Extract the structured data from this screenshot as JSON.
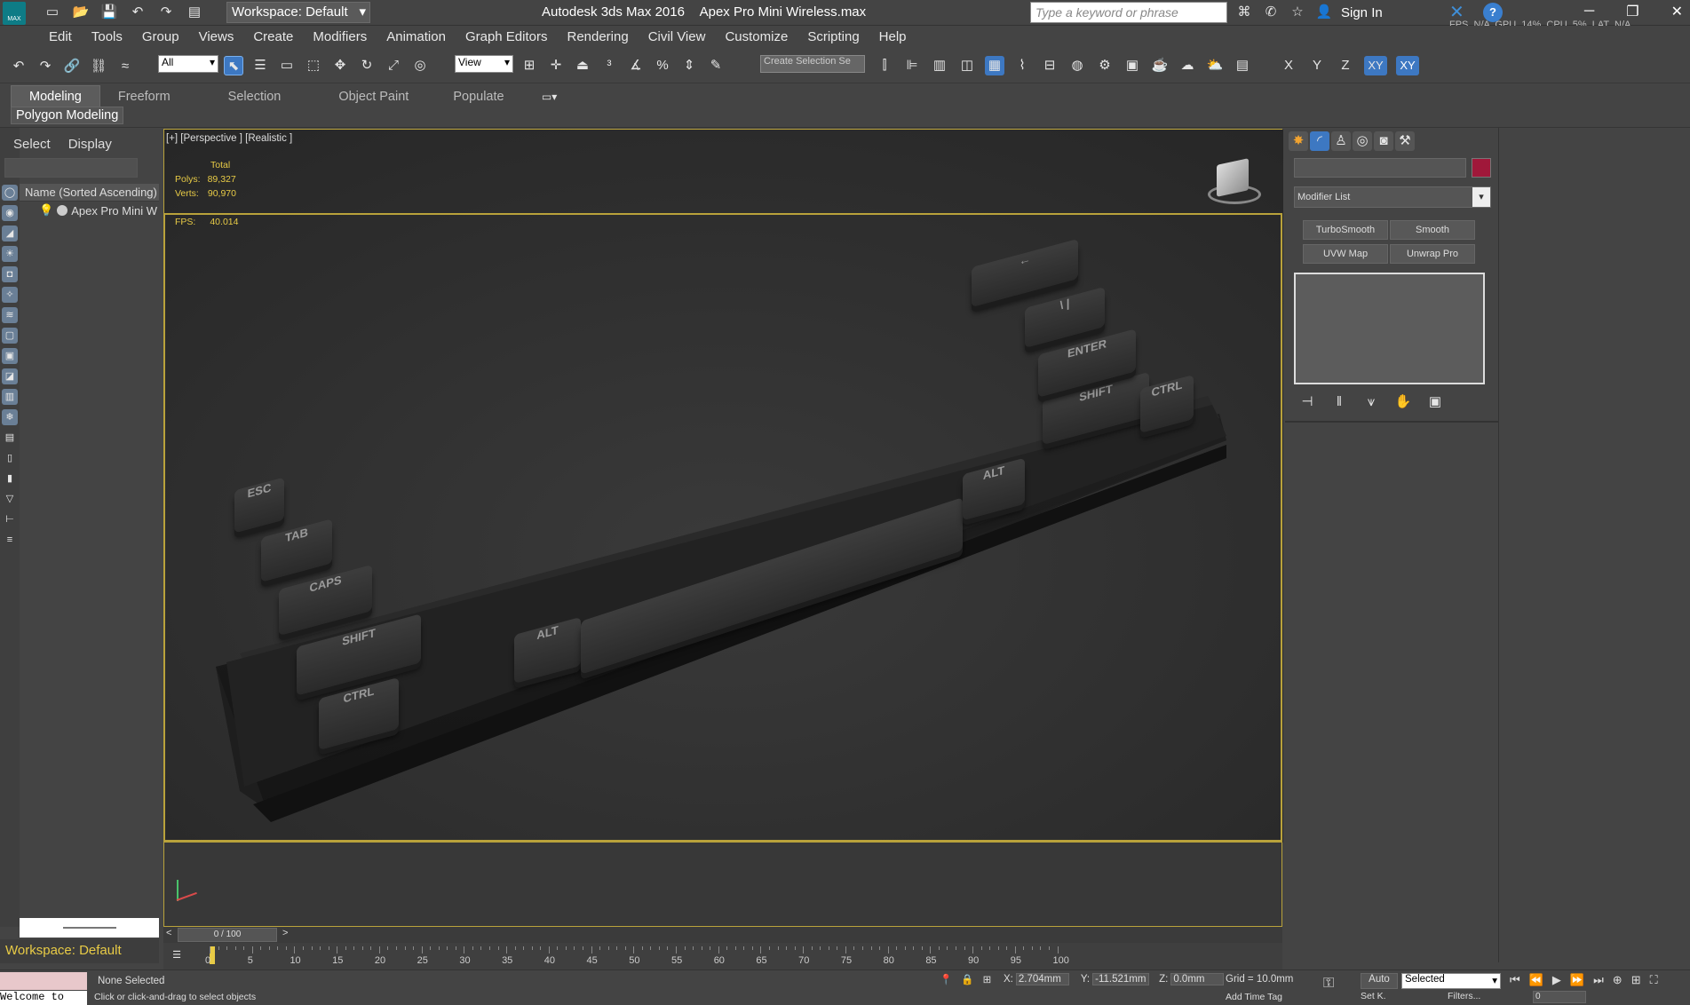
{
  "titlebar": {
    "workspace_label": "Workspace: Default",
    "app_title": "Autodesk 3ds Max 2016",
    "file_name": "Apex Pro Mini Wireless.max",
    "search_placeholder": "Type a keyword or phrase",
    "sign_in": "Sign In",
    "app_logo": "MAX",
    "stats": "FPS  N/A  GPU  14%  CPU  5%  LAT  N/A"
  },
  "menubar": {
    "items": [
      "Edit",
      "Tools",
      "Group",
      "Views",
      "Create",
      "Modifiers",
      "Animation",
      "Graph Editors",
      "Rendering",
      "Civil View",
      "Customize",
      "Scripting",
      "Help"
    ]
  },
  "toolbar": {
    "filter_select": "All",
    "coord_select": "View",
    "selection_set_placeholder": "Create Selection Se",
    "axes": [
      "X",
      "Y",
      "Z",
      "XY",
      "XY"
    ]
  },
  "ribbon": {
    "tabs": [
      "Modeling",
      "Freeform",
      "Selection",
      "Object Paint",
      "Populate"
    ],
    "active_tab": "Modeling",
    "sub_label": "Polygon Modeling"
  },
  "scene_explorer": {
    "tabs": [
      "Select",
      "Display"
    ],
    "column_header": "Name (Sorted Ascending)",
    "object_name": "Apex Pro Mini W",
    "workspace": "Workspace: Default"
  },
  "viewport": {
    "label": "[+] [Perspective ] [Realistic ]",
    "stats_total": "Total",
    "polys_label": "Polys:",
    "polys_value": "89,327",
    "verts_label": "Verts:",
    "verts_value": "90,970",
    "fps_label": "FPS:",
    "fps_value": "40.014"
  },
  "keyboard": {
    "keys": {
      "esc": "ESC",
      "tab": "TAB",
      "caps": "CAPS",
      "shift_l": "SHIFT",
      "ctrl_l": "CTRL",
      "alt_l": "ALT",
      "alt_r": "ALT",
      "shift_r": "SHIFT",
      "ctrl_r": "CTRL",
      "enter": "ENTER",
      "back": "←",
      "pipe": "\\ |"
    }
  },
  "command_panel": {
    "modifier_list": "Modifier List",
    "buttons": [
      "TurboSmooth",
      "Smooth",
      "UVW Map",
      "Unwrap Pro"
    ],
    "color_swatch": "#a0183a"
  },
  "timeline": {
    "frame_counter": "0 / 100",
    "ticks": [
      "0",
      "5",
      "10",
      "15",
      "20",
      "25",
      "30",
      "35",
      "40",
      "45",
      "50",
      "55",
      "60",
      "65",
      "70",
      "75",
      "80",
      "85",
      "90",
      "95",
      "100"
    ]
  },
  "statusbar": {
    "maxscript_text": "Welcome to",
    "selection_status": "None Selected",
    "prompt": "Click or click-and-drag to select objects",
    "x_label": "X:",
    "x_value": "2.704mm",
    "y_label": "Y:",
    "y_value": "-11.521mm",
    "z_label": "Z:",
    "z_value": "0.0mm",
    "grid": "Grid = 10.0mm",
    "add_time_tag": "Add Time Tag",
    "auto": "Auto",
    "set_key": "Set K.",
    "selected_dropdown": "Selected",
    "filters": "Filters...",
    "frame_field": "0"
  }
}
